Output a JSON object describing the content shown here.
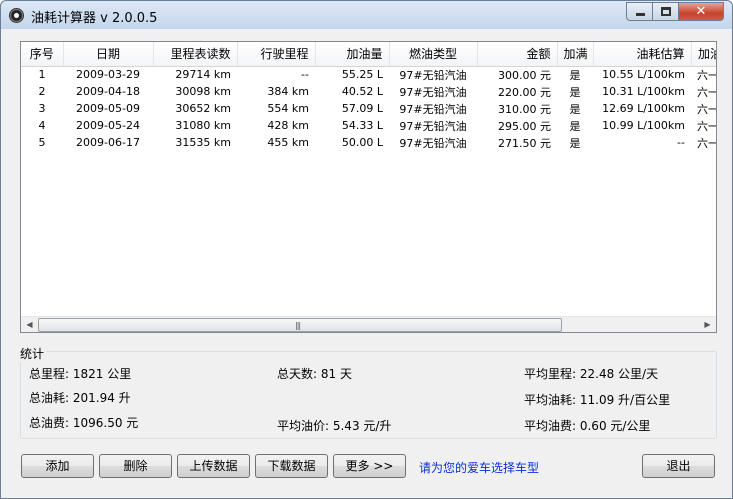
{
  "window": {
    "title": "油耗计算器 v 2.0.0.5"
  },
  "table": {
    "columns": [
      "序号",
      "日期",
      "里程表读数",
      "行驶里程",
      "加油量",
      "燃油类型",
      "金额",
      "加满",
      "油耗估算",
      "加油站"
    ],
    "rows": [
      [
        "1",
        "2009-03-29",
        "29714 km",
        "--",
        "55.25 L",
        "97#无铅汽油",
        "300.00 元",
        "是",
        "10.55 L/100km",
        "六一路加"
      ],
      [
        "2",
        "2009-04-18",
        "30098 km",
        "384 km",
        "40.52 L",
        "97#无铅汽油",
        "220.00 元",
        "是",
        "10.31 L/100km",
        "六一路加"
      ],
      [
        "3",
        "2009-05-09",
        "30652 km",
        "554 km",
        "57.09 L",
        "97#无铅汽油",
        "310.00 元",
        "是",
        "12.69 L/100km",
        "六一路加"
      ],
      [
        "4",
        "2009-05-24",
        "31080 km",
        "428 km",
        "54.33 L",
        "97#无铅汽油",
        "295.00 元",
        "是",
        "10.99 L/100km",
        "六一路加"
      ],
      [
        "5",
        "2009-06-17",
        "31535 km",
        "455 km",
        "50.00 L",
        "97#无铅汽油",
        "271.50 元",
        "是",
        "--",
        "六一路加"
      ]
    ]
  },
  "stats": {
    "title": "统计",
    "total_mileage": "总里程: 1821 公里",
    "total_days": "总天数: 81 天",
    "avg_mileage": "平均里程: 22.48 公里/天",
    "total_fuel": "总油耗: 201.94 升",
    "avg_fuel": "平均油耗: 11.09 升/百公里",
    "total_cost": "总油费: 1096.50 元",
    "avg_price": "平均油价: 5.43 元/升",
    "avg_cost": "平均油费: 0.60 元/公里"
  },
  "buttons": {
    "add": "添加",
    "delete": "删除",
    "upload": "上传数据",
    "download": "下载数据",
    "more": "更多 >>",
    "exit": "退出"
  },
  "link": "请为您的爱车选择车型",
  "icons": {
    "app": "app-icon",
    "minimize": "minimize-icon",
    "maximize": "maximize-icon",
    "close": "close-icon",
    "scroll_left": "scroll-left-arrow-icon",
    "scroll_right": "scroll-right-arrow-icon"
  },
  "colors": {
    "link": "#0a2ee0",
    "close_button": "#c7432e"
  }
}
